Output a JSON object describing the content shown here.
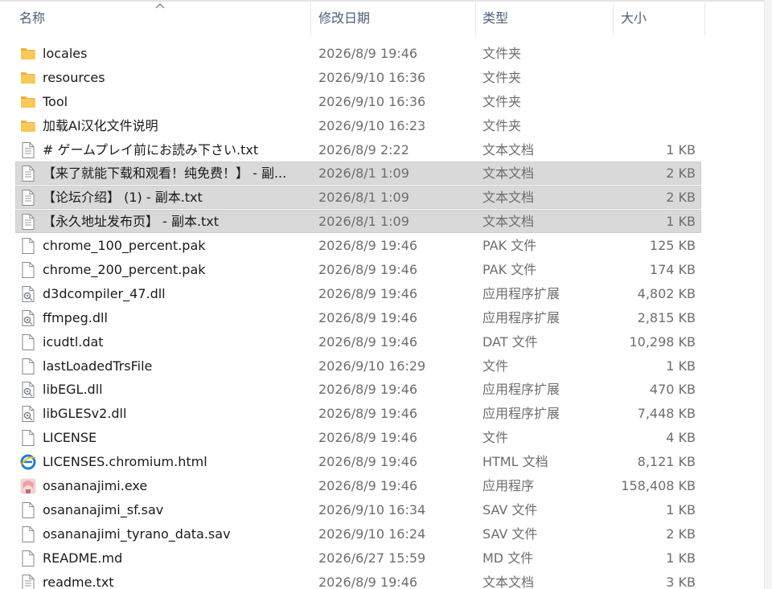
{
  "columns": {
    "name": "名称",
    "date": "修改日期",
    "type": "类型",
    "size": "大小"
  },
  "sort": {
    "column": "name",
    "direction": "ascending",
    "icon": "sort-up-icon"
  },
  "colors": {
    "selection": "#d9d9d9",
    "header_text": "#4c607a",
    "folder": "#f6c452",
    "meta_text": "#6d6d6d"
  },
  "files": [
    {
      "name": "locales",
      "date": "2026/8/9 19:46",
      "type": "文件夹",
      "size": "",
      "icon": "folder",
      "selected": false
    },
    {
      "name": "resources",
      "date": "2026/9/10 16:36",
      "type": "文件夹",
      "size": "",
      "icon": "folder",
      "selected": false
    },
    {
      "name": "Tool",
      "date": "2026/9/10 16:36",
      "type": "文件夹",
      "size": "",
      "icon": "folder",
      "selected": false
    },
    {
      "name": "加载AI汉化文件说明",
      "date": "2026/9/10 16:23",
      "type": "文件夹",
      "size": "",
      "icon": "folder",
      "selected": false
    },
    {
      "name": "# ゲームプレイ前にお読み下さい.txt",
      "date": "2026/8/9 2:22",
      "type": "文本文档",
      "size": "1 KB",
      "icon": "text",
      "selected": false
    },
    {
      "name": "【来了就能下载和观看！纯免费！】 - 副...",
      "date": "2026/8/1 1:09",
      "type": "文本文档",
      "size": "2 KB",
      "icon": "text",
      "selected": true
    },
    {
      "name": "【论坛介绍】 (1) - 副本.txt",
      "date": "2026/8/1 1:09",
      "type": "文本文档",
      "size": "2 KB",
      "icon": "text",
      "selected": true
    },
    {
      "name": "【永久地址发布页】  - 副本.txt",
      "date": "2026/8/1 1:09",
      "type": "文本文档",
      "size": "1 KB",
      "icon": "text",
      "selected": true
    },
    {
      "name": "chrome_100_percent.pak",
      "date": "2026/8/9 19:46",
      "type": "PAK 文件",
      "size": "125 KB",
      "icon": "blank",
      "selected": false
    },
    {
      "name": "chrome_200_percent.pak",
      "date": "2026/8/9 19:46",
      "type": "PAK 文件",
      "size": "174 KB",
      "icon": "blank",
      "selected": false
    },
    {
      "name": "d3dcompiler_47.dll",
      "date": "2026/8/9 19:46",
      "type": "应用程序扩展",
      "size": "4,802 KB",
      "icon": "dll",
      "selected": false
    },
    {
      "name": "ffmpeg.dll",
      "date": "2026/8/9 19:46",
      "type": "应用程序扩展",
      "size": "2,815 KB",
      "icon": "dll",
      "selected": false
    },
    {
      "name": "icudtl.dat",
      "date": "2026/8/9 19:46",
      "type": "DAT 文件",
      "size": "10,298 KB",
      "icon": "blank",
      "selected": false
    },
    {
      "name": "lastLoadedTrsFile",
      "date": "2026/9/10 16:29",
      "type": "文件",
      "size": "1 KB",
      "icon": "blank",
      "selected": false
    },
    {
      "name": "libEGL.dll",
      "date": "2026/8/9 19:46",
      "type": "应用程序扩展",
      "size": "470 KB",
      "icon": "dll",
      "selected": false
    },
    {
      "name": "libGLESv2.dll",
      "date": "2026/8/9 19:46",
      "type": "应用程序扩展",
      "size": "7,448 KB",
      "icon": "dll",
      "selected": false
    },
    {
      "name": "LICENSE",
      "date": "2026/8/9 19:46",
      "type": "文件",
      "size": "4 KB",
      "icon": "blank",
      "selected": false
    },
    {
      "name": "LICENSES.chromium.html",
      "date": "2026/8/9 19:46",
      "type": "HTML 文档",
      "size": "8,121 KB",
      "icon": "html",
      "selected": false
    },
    {
      "name": "osananajimi.exe",
      "date": "2026/8/9 19:46",
      "type": "应用程序",
      "size": "158,408 KB",
      "icon": "exe",
      "selected": false
    },
    {
      "name": "osananajimi_sf.sav",
      "date": "2026/9/10 16:34",
      "type": "SAV 文件",
      "size": "1 KB",
      "icon": "blank",
      "selected": false
    },
    {
      "name": "osananajimi_tyrano_data.sav",
      "date": "2026/9/10 16:24",
      "type": "SAV 文件",
      "size": "2 KB",
      "icon": "blank",
      "selected": false
    },
    {
      "name": "README.md",
      "date": "2026/6/27 15:59",
      "type": "MD 文件",
      "size": "1 KB",
      "icon": "blank",
      "selected": false
    },
    {
      "name": "readme.txt",
      "date": "2026/8/9 19:46",
      "type": "文本文档",
      "size": "3 KB",
      "icon": "text",
      "selected": false
    }
  ]
}
